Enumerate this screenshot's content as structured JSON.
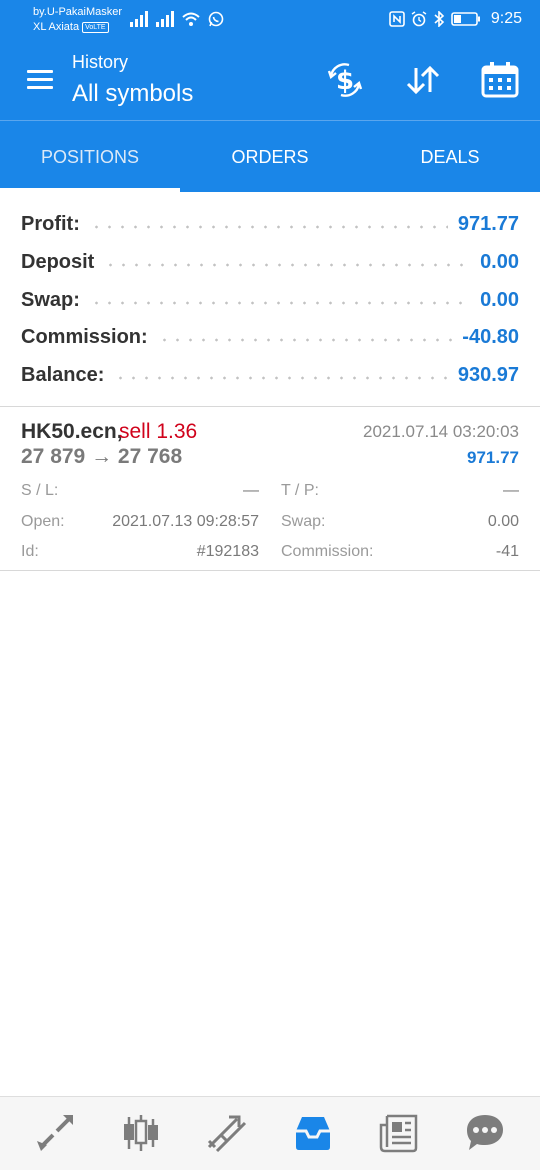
{
  "status_bar": {
    "carrier_line1": "by.U-PakaiMasker",
    "carrier_line2": "XL Axiata",
    "volte": "VoLTE",
    "time": "9:25"
  },
  "app_bar": {
    "title_small": "History",
    "title_big": "All symbols",
    "icons": [
      "menu-icon",
      "currency-exchange-icon",
      "sort-icon",
      "calendar-icon"
    ]
  },
  "tabs": {
    "positions": "POSITIONS",
    "orders": "ORDERS",
    "deals": "DEALS",
    "active": "positions"
  },
  "summary": {
    "profit": {
      "label": "Profit:",
      "value": "971.77"
    },
    "deposit": {
      "label": "Deposit",
      "value": "0.00"
    },
    "swap": {
      "label": "Swap:",
      "value": "0.00"
    },
    "commission": {
      "label": "Commission:",
      "value": "-40.80"
    },
    "balance": {
      "label": "Balance:",
      "value": "930.97"
    }
  },
  "position": {
    "symbol": "HK50.ecn,",
    "side": "sell 1.36",
    "prices": "27 879 → 27 768",
    "close_time": "2021.07.14 03:20:03",
    "profit": "971.77",
    "sl_label": "S / L:",
    "sl_value": "—",
    "tp_label": "T / P:",
    "tp_value": "—",
    "open_label": "Open:",
    "open_value": "2021.07.13 09:28:57",
    "swap_label": "Swap:",
    "swap_value": "0.00",
    "id_label": "Id:",
    "id_value": "#192183",
    "commission_label": "Commission:",
    "commission_value": "-41"
  },
  "bottom_nav": [
    "quotes-icon",
    "chart-icon",
    "trade-icon",
    "history-icon",
    "news-icon",
    "chat-icon"
  ],
  "colors": {
    "accent": "#1a86e8",
    "value_blue": "#1a7ad6",
    "sell_red": "#d0021b"
  }
}
